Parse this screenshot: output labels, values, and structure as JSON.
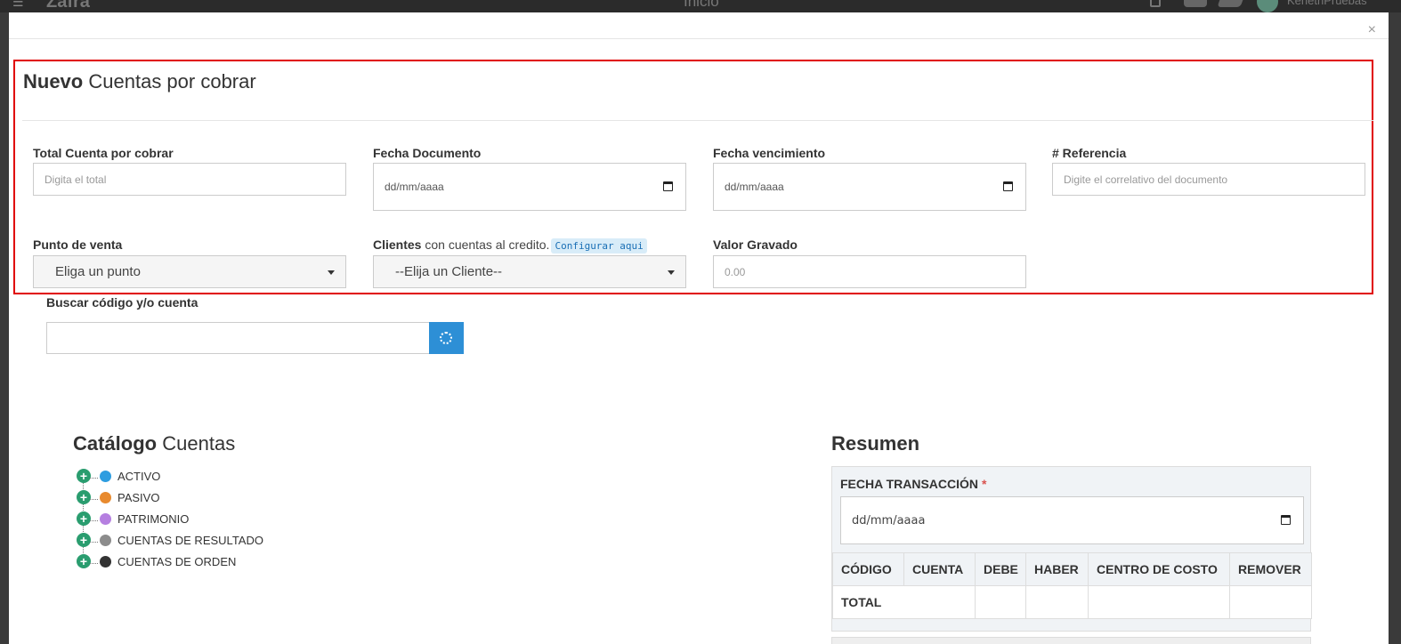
{
  "appbar": {
    "brand": "Zafra",
    "center_title": "Inicio",
    "user": "KenethPruebas"
  },
  "modal": {
    "close": "×"
  },
  "form": {
    "title_bold": "Nuevo",
    "title_rest": "Cuentas por cobrar",
    "total": {
      "label": "Total Cuenta por cobrar",
      "placeholder": "Digita el total"
    },
    "fecha_documento": {
      "label": "Fecha Documento",
      "value": "dd/mm/aaaa"
    },
    "fecha_vencimiento": {
      "label": "Fecha vencimiento",
      "value": "dd/mm/aaaa"
    },
    "referencia": {
      "label": "# Referencia",
      "placeholder": "Digite el correlativo del documento"
    },
    "punto_venta": {
      "label": "Punto de venta",
      "selected": "Eliga un punto"
    },
    "clientes": {
      "label_bold": "Clientes",
      "label_rest": "con cuentas al credito.",
      "config_link": "Configurar aqui",
      "selected": "--Elija un Cliente--"
    },
    "valor_gravado": {
      "label": "Valor Gravado",
      "placeholder": "0.00"
    }
  },
  "search": {
    "label": "Buscar código y/o cuenta",
    "value": ""
  },
  "catalogo": {
    "title_bold": "Catálogo",
    "title_rest": "Cuentas",
    "items": [
      {
        "label": "ACTIVO",
        "color": "#2d9de0"
      },
      {
        "label": "PASIVO",
        "color": "#e88a2e"
      },
      {
        "label": "PATRIMONIO",
        "color": "#b57fe0"
      },
      {
        "label": "CUENTAS DE RESULTADO",
        "color": "#8c8c8c"
      },
      {
        "label": "CUENTAS DE ORDEN",
        "color": "#333333"
      }
    ]
  },
  "resumen": {
    "title": "Resumen",
    "fecha_label": "FECHA TRANSACCIÓN",
    "required_mark": "*",
    "fecha_value": "dd/mm/aaaa",
    "columns": [
      "CÓDIGO",
      "CUENTA",
      "DEBE",
      "HABER",
      "CENTRO DE COSTO",
      "REMOVER"
    ],
    "total_label": "TOTAL"
  },
  "colors": {
    "highlight_border": "#e00000",
    "primary": "#2d8fd6",
    "tree_plus": "#2a9d6f"
  }
}
